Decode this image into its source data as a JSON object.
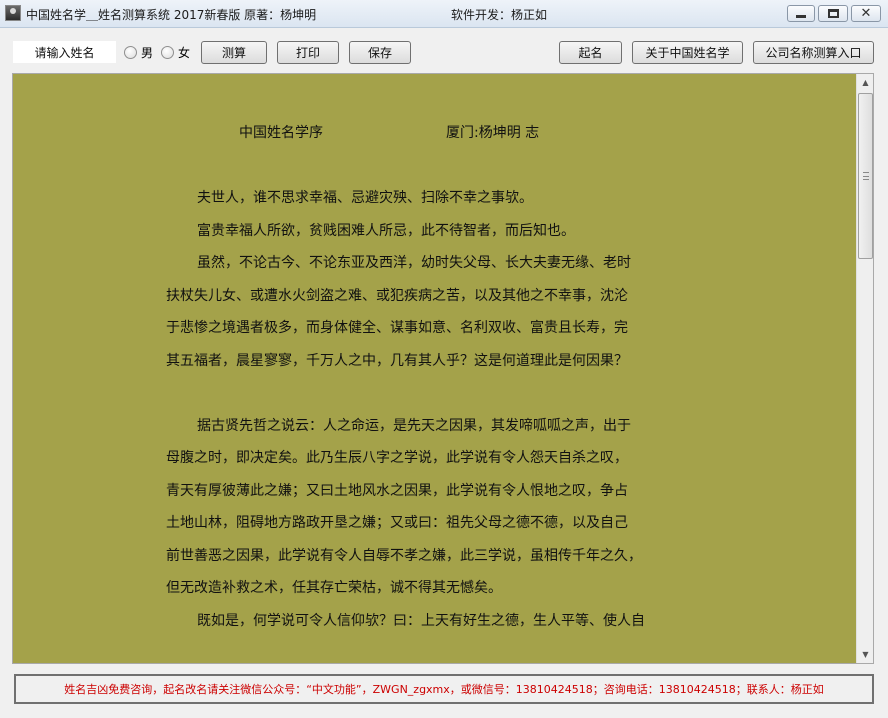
{
  "window": {
    "title": "中国姓名学＿姓名测算系统 2017新春版   原著：杨坤明",
    "developer": "软件开发：杨正如",
    "controls": {
      "minimize_icon": "minimize-icon",
      "maximize_icon": "maximize-icon",
      "close_icon": "close-icon"
    }
  },
  "toolbar": {
    "name_input": {
      "value": "请输入姓名",
      "placeholder": "请输入姓名"
    },
    "gender": {
      "male_label": "男",
      "female_label": "女"
    },
    "measure_label": "测算",
    "print_label": "打印",
    "save_label": "保存",
    "naming_label": "起名",
    "about_label": "关于中国姓名学",
    "company_label": "公司名称测算入口"
  },
  "document": {
    "title": "中国姓名学序",
    "author": "厦门:杨坤明 志",
    "lines": [
      "夫世人，谁不思求幸福、忌避灾殃、扫除不幸之事欤。",
      "富贵幸福人所欲，贫贱困难人所忌，此不待智者，而后知也。",
      "虽然，不论古今、不论东亚及西洋，幼时失父母、长大夫妻无缘、老时",
      "扶杖失儿女、或遭水火剑盗之难、或犯疾病之苦，以及其他之不幸事，沈沦",
      "于悲惨之境遇者极多，而身体健全、谋事如意、名利双收、富贵且长寿，完",
      "其五福者，晨星寥寥，千万人之中，几有其人乎？这是何道理此是何因果？",
      "",
      "据古贤先哲之说云：人之命运，是先天之因果，其发啼呱呱之声，出于",
      "母腹之时，即决定矣。此乃生辰八字之学说，此学说有令人怨天自杀之叹，",
      "青天有厚彼薄此之嫌；又曰土地风水之因果，此学说有令人恨地之叹，争占",
      "土地山林，阻碍地方路政开垦之嫌；又或曰：祖先父母之德不德，以及自己",
      "前世善恶之因果，此学说有令人自辱不孝之嫌，此三学说，虽相传千年之久，",
      "但无改造补救之术，任其存亡荣枯，诚不得其无憾矣。",
      "既如是，何学说可令人信仰欤？曰：上天有好生之德，生人平等、使人自"
    ]
  },
  "status": {
    "text": "姓名吉凶免费咨询，起名改名请关注微信公众号：“中文功能”，ZWGN_zgxmx，或微信号：13810424518；咨询电话：13810424518；联系人：杨正如"
  },
  "colors": {
    "document_background": "#a4a24a",
    "status_text": "#cc0000",
    "window_background": "#f0f0f0"
  }
}
